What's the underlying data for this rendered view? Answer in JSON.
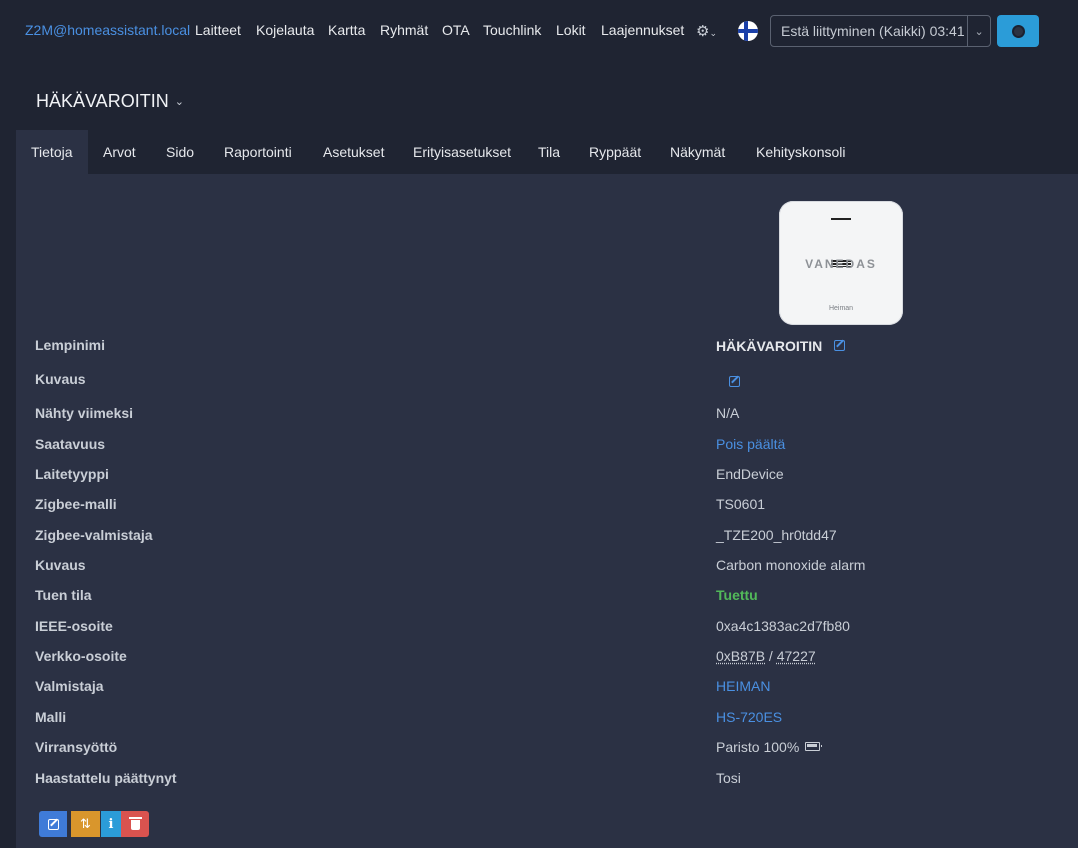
{
  "navbar": {
    "brand": "Z2M@homeassistant.local",
    "links": [
      "Laitteet",
      "Kojelauta",
      "Kartta",
      "Ryhmät",
      "OTA",
      "Touchlink",
      "Lokit",
      "Laajennukset"
    ],
    "settings_icon": "gear-icon",
    "language_icon": "flag-finland-icon",
    "permit_join_label": "Estä liittyminen (Kaikki) 03:41",
    "map_icon": "map-icon"
  },
  "device": {
    "title": "HÄKÄVAROITIN",
    "image_logo": "VANEDAS",
    "image_brand": "Heiman"
  },
  "tabs": [
    "Tietoja",
    "Arvot",
    "Sido",
    "Raportointi",
    "Asetukset",
    "Erityisasetukset",
    "Tila",
    "Ryppäät",
    "Näkymät",
    "Kehityskonsoli"
  ],
  "active_tab": "Tietoja",
  "info": {
    "rows": [
      {
        "label": "Lempinimi",
        "value": "HÄKÄVAROITIN"
      },
      {
        "label": "Kuvaus",
        "value": ""
      },
      {
        "label": "Nähty viimeksi",
        "value": "N/A"
      },
      {
        "label": "Saatavuus",
        "value": "Pois päältä"
      },
      {
        "label": "Laitetyyppi",
        "value": "EndDevice"
      },
      {
        "label": "Zigbee-malli",
        "value": "TS0601"
      },
      {
        "label": "Zigbee-valmistaja",
        "value": "_TZE200_hr0tdd47"
      },
      {
        "label": "Kuvaus",
        "value": "Carbon monoxide alarm"
      },
      {
        "label": "Tuen tila",
        "value": "Tuettu"
      },
      {
        "label": "IEEE-osoite",
        "value": "0xa4c1383ac2d7fb80"
      },
      {
        "label": "Verkko-osoite",
        "value_hex": "0xB87B",
        "value_sep": " / ",
        "value_dec": "47227"
      },
      {
        "label": "Valmistaja",
        "value": "HEIMAN"
      },
      {
        "label": "Malli",
        "value": "HS-720ES"
      },
      {
        "label": "Virransyöttö",
        "value": "Paristo 100%"
      },
      {
        "label": "Haastattelu päättynyt",
        "value": "Tosi"
      }
    ]
  },
  "colors": {
    "background": "#1f2432",
    "panel": "#2b3144",
    "link": "#4a90e2",
    "success": "#52b95a",
    "edit_button": "#3f7bd8",
    "interview_button": "#d9962c",
    "info_button": "#2b9cd8",
    "delete_button": "#d9534f"
  },
  "actions": {
    "edit_icon": "edit-icon",
    "interview_icon": "refresh-icon",
    "info_label": "i",
    "delete_icon": "trash-icon"
  }
}
